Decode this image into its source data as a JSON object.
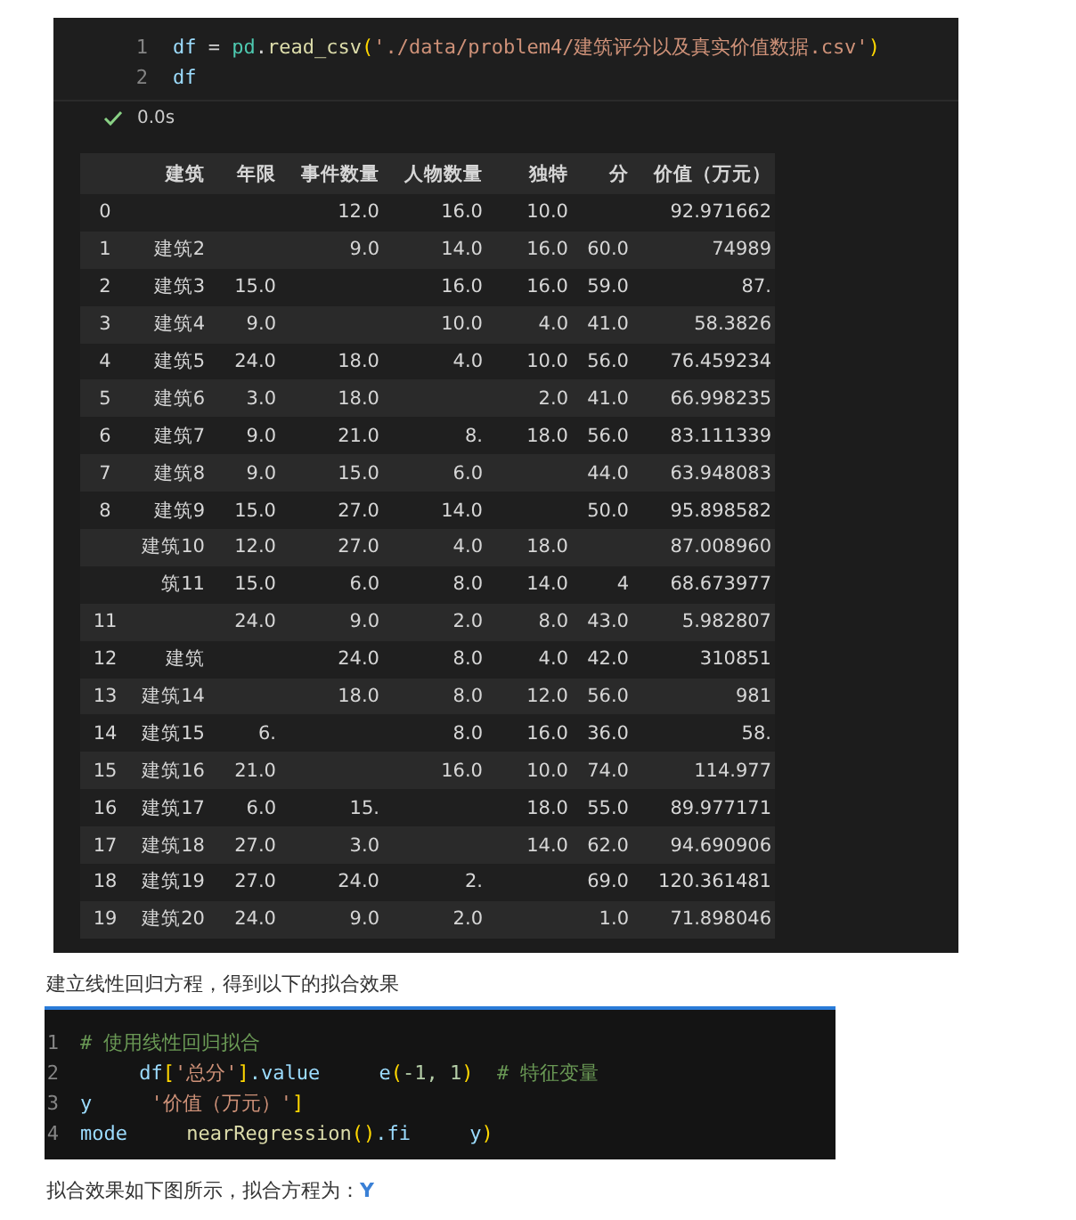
{
  "notebook": {
    "code_lines": [
      {
        "number": "1",
        "tokens": [
          {
            "kind": "var",
            "text": "df"
          },
          {
            "kind": "op",
            "text": " = "
          },
          {
            "kind": "module",
            "text": "pd"
          },
          {
            "kind": "op",
            "text": "."
          },
          {
            "kind": "func",
            "text": "read_csv"
          },
          {
            "kind": "paren",
            "text": "("
          },
          {
            "kind": "string",
            "text": "'./data/problem4/建筑评分以及真实价值数据.csv'"
          },
          {
            "kind": "paren",
            "text": ")"
          }
        ]
      },
      {
        "number": "2",
        "tokens": [
          {
            "kind": "var",
            "text": "df"
          }
        ]
      }
    ],
    "status": {
      "time": "0.0s"
    },
    "table": {
      "columns": [
        "建筑",
        "年限",
        "事件数量",
        "人物数量",
        "独特",
        "分",
        "价值（万元）"
      ],
      "rows": [
        {
          "index": "0",
          "cells": [
            null,
            null,
            "12.0",
            "16.0",
            "10.0",
            null,
            "92.971662"
          ]
        },
        {
          "index": "1",
          "cells": [
            "建筑2",
            null,
            "9.0",
            "14.0",
            "16.0",
            "60.0",
            "74989"
          ]
        },
        {
          "index": "2",
          "cells": [
            "建筑3",
            "15.0",
            null,
            "16.0",
            "16.0",
            "59.0",
            "87."
          ]
        },
        {
          "index": "3",
          "cells": [
            "建筑4",
            "9.0",
            null,
            "10.0",
            "4.0",
            "41.0",
            "58.3826"
          ]
        },
        {
          "index": "4",
          "cells": [
            "建筑5",
            "24.0",
            "18.0",
            "4.0",
            "10.0",
            "56.0",
            "76.459234"
          ]
        },
        {
          "index": "5",
          "cells": [
            "建筑6",
            "3.0",
            "18.0",
            null,
            "2.0",
            "41.0",
            "66.998235"
          ]
        },
        {
          "index": "6",
          "cells": [
            "建筑7",
            "9.0",
            "21.0",
            "8.",
            "18.0",
            "56.0",
            "83.111339"
          ]
        },
        {
          "index": "7",
          "cells": [
            "建筑8",
            "9.0",
            "15.0",
            "6.0",
            null,
            "44.0",
            "63.948083"
          ]
        },
        {
          "index": "8",
          "cells": [
            "建筑9",
            "15.0",
            "27.0",
            "14.0",
            null,
            "50.0",
            "95.898582"
          ]
        },
        {
          "index": null,
          "cells": [
            "建筑10",
            "12.0",
            "27.0",
            "4.0",
            "18.0",
            null,
            "87.008960"
          ]
        },
        {
          "index": null,
          "cells": [
            "筑11",
            "15.0",
            "6.0",
            "8.0",
            "14.0",
            "4",
            "68.673977"
          ]
        },
        {
          "index": "11",
          "cells": [
            null,
            "24.0",
            "9.0",
            "2.0",
            "8.0",
            "43.0",
            "5.982807"
          ]
        },
        {
          "index": "12",
          "cells": [
            "建筑",
            null,
            "24.0",
            "8.0",
            "4.0",
            "42.0",
            "310851"
          ]
        },
        {
          "index": "13",
          "cells": [
            "建筑14",
            null,
            "18.0",
            "8.0",
            "12.0",
            "56.0",
            "981"
          ]
        },
        {
          "index": "14",
          "cells": [
            "建筑15",
            "6.",
            null,
            "8.0",
            "16.0",
            "36.0",
            "58."
          ]
        },
        {
          "index": "15",
          "cells": [
            "建筑16",
            "21.0",
            null,
            "16.0",
            "10.0",
            "74.0",
            "114.977"
          ]
        },
        {
          "index": "16",
          "cells": [
            "建筑17",
            "6.0",
            "15.",
            null,
            "18.0",
            "55.0",
            "89.977171"
          ]
        },
        {
          "index": "17",
          "cells": [
            "建筑18",
            "27.0",
            "3.0",
            null,
            "14.0",
            "62.0",
            "94.690906"
          ]
        },
        {
          "index": "18",
          "cells": [
            "建筑19",
            "27.0",
            "24.0",
            "2.",
            null,
            "69.0",
            "120.361481"
          ]
        },
        {
          "index": "19",
          "cells": [
            "建筑20",
            "24.0",
            "9.0",
            "2.0",
            null,
            "1.0",
            "71.898046"
          ]
        }
      ]
    }
  },
  "paragraph_1": "建立线性回归方程，得到以下的拟合效果",
  "code_image": {
    "lines": [
      {
        "number": "1",
        "tokens": [
          {
            "kind": "comment",
            "text": "# 使用线性回归拟合"
          }
        ]
      },
      {
        "number": "2",
        "tokens": [
          {
            "kind": "var",
            "text": "     df"
          },
          {
            "kind": "paren",
            "text": "["
          },
          {
            "kind": "string",
            "text": "'总分'"
          },
          {
            "kind": "paren",
            "text": "]"
          },
          {
            "kind": "var",
            "text": ".value"
          },
          {
            "kind": "gap"
          },
          {
            "kind": "var",
            "text": "e"
          },
          {
            "kind": "paren",
            "text": "("
          },
          {
            "kind": "number",
            "text": "-1, 1"
          },
          {
            "kind": "paren",
            "text": ")"
          },
          {
            "kind": "comment",
            "text": "  # 特征变量"
          }
        ]
      },
      {
        "number": "3",
        "tokens": [
          {
            "kind": "var",
            "text": "y"
          },
          {
            "kind": "gap"
          },
          {
            "kind": "string",
            "text": "'价值（万元）'"
          },
          {
            "kind": "paren",
            "text": "]"
          }
        ]
      },
      {
        "number": "4",
        "tokens": [
          {
            "kind": "var",
            "text": "mode"
          },
          {
            "kind": "gap"
          },
          {
            "kind": "func",
            "text": "nearRegression"
          },
          {
            "kind": "paren",
            "text": "()"
          },
          {
            "kind": "var",
            "text": ".fi"
          },
          {
            "kind": "gap"
          },
          {
            "kind": "var",
            "text": "y"
          },
          {
            "kind": "paren",
            "text": ")"
          }
        ]
      }
    ]
  },
  "paragraph_2": {
    "text": "拟合效果如下图所示，拟合方程为：",
    "highlight": "Y"
  }
}
